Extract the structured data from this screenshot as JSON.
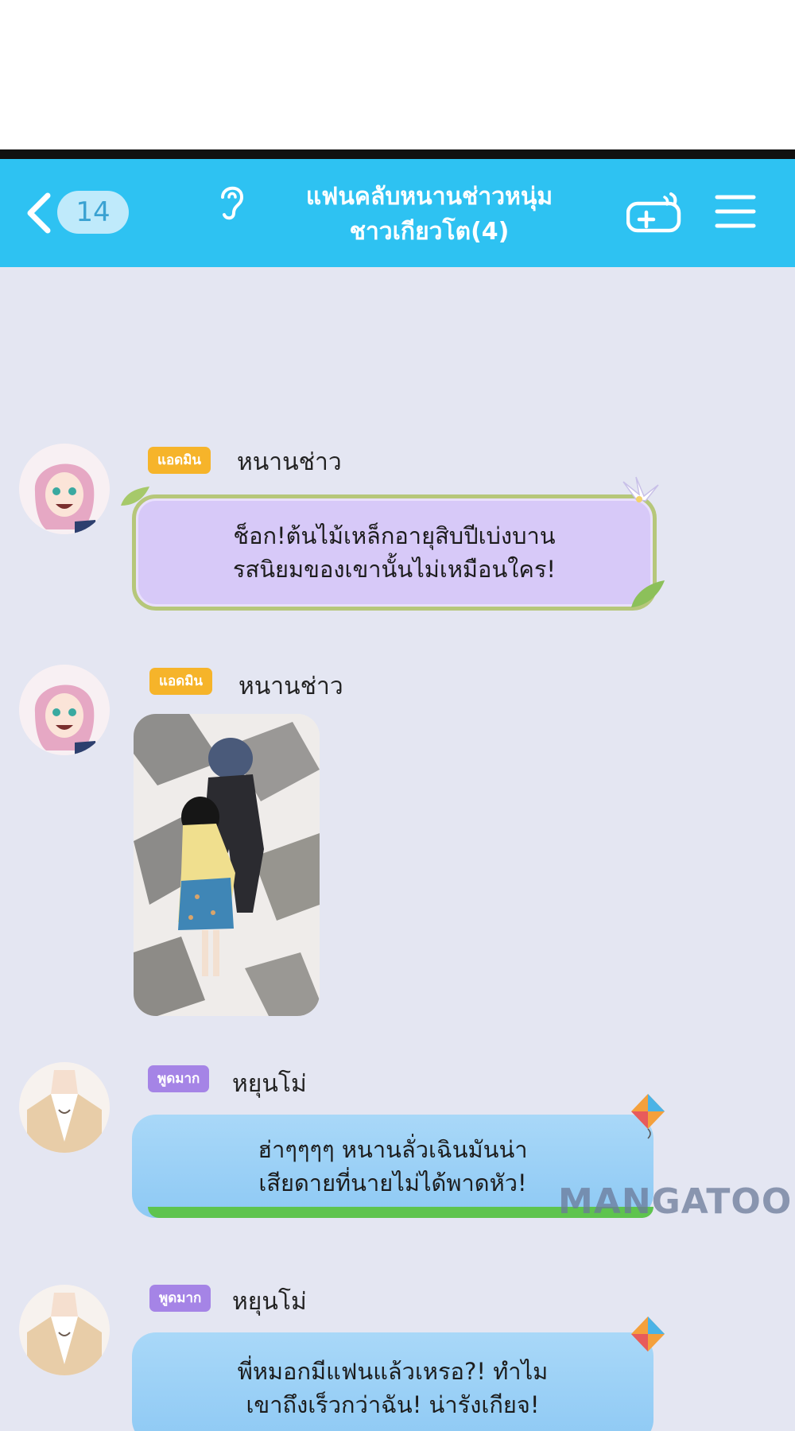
{
  "header": {
    "count": "14",
    "title_line1": "แฟนคลับหนานช่าวหนุ่ม",
    "title_line2": "ชาวเกียวโต(4)"
  },
  "messages": [
    {
      "badge": "แอดมิน",
      "sender": "หนานช่าว",
      "line1": "ช็อก!ต้นไม้เหล็กอายุสิบปีเบ่งบาน",
      "line2": "รสนิยมของเขานั้นไม่เหมือนใคร!"
    },
    {
      "badge": "แอดมิน",
      "sender": "หนานช่าว"
    },
    {
      "badge": "พูดมาก",
      "sender": "หยุนโม่",
      "line1": "ฮ่าๆๆๆๆ หนานลั่วเฉินมันน่า",
      "line2": "เสียดายที่นายไม่ได้พาดหัว!"
    },
    {
      "badge": "พูดมาก",
      "sender": "หยุนโม่",
      "line1": "พี่หมอกมีแฟนแล้วเหรอ?! ทำไม",
      "line2": "เขาถึงเร็วกว่าฉัน! น่ารังเกียจ!"
    }
  ],
  "watermark": "MANGATOON",
  "colors": {
    "header": "#2ec2f2",
    "chat_bg": "#e4e6f2",
    "admin_badge": "#f6b42a",
    "talk_badge": "#a584e6",
    "purple_bubble": "#d7c9f8",
    "blue_bubble": "#a9d8f8"
  },
  "icons": [
    "back-chevron-icon",
    "ear-icon",
    "gamepad-icon",
    "menu-icon"
  ]
}
